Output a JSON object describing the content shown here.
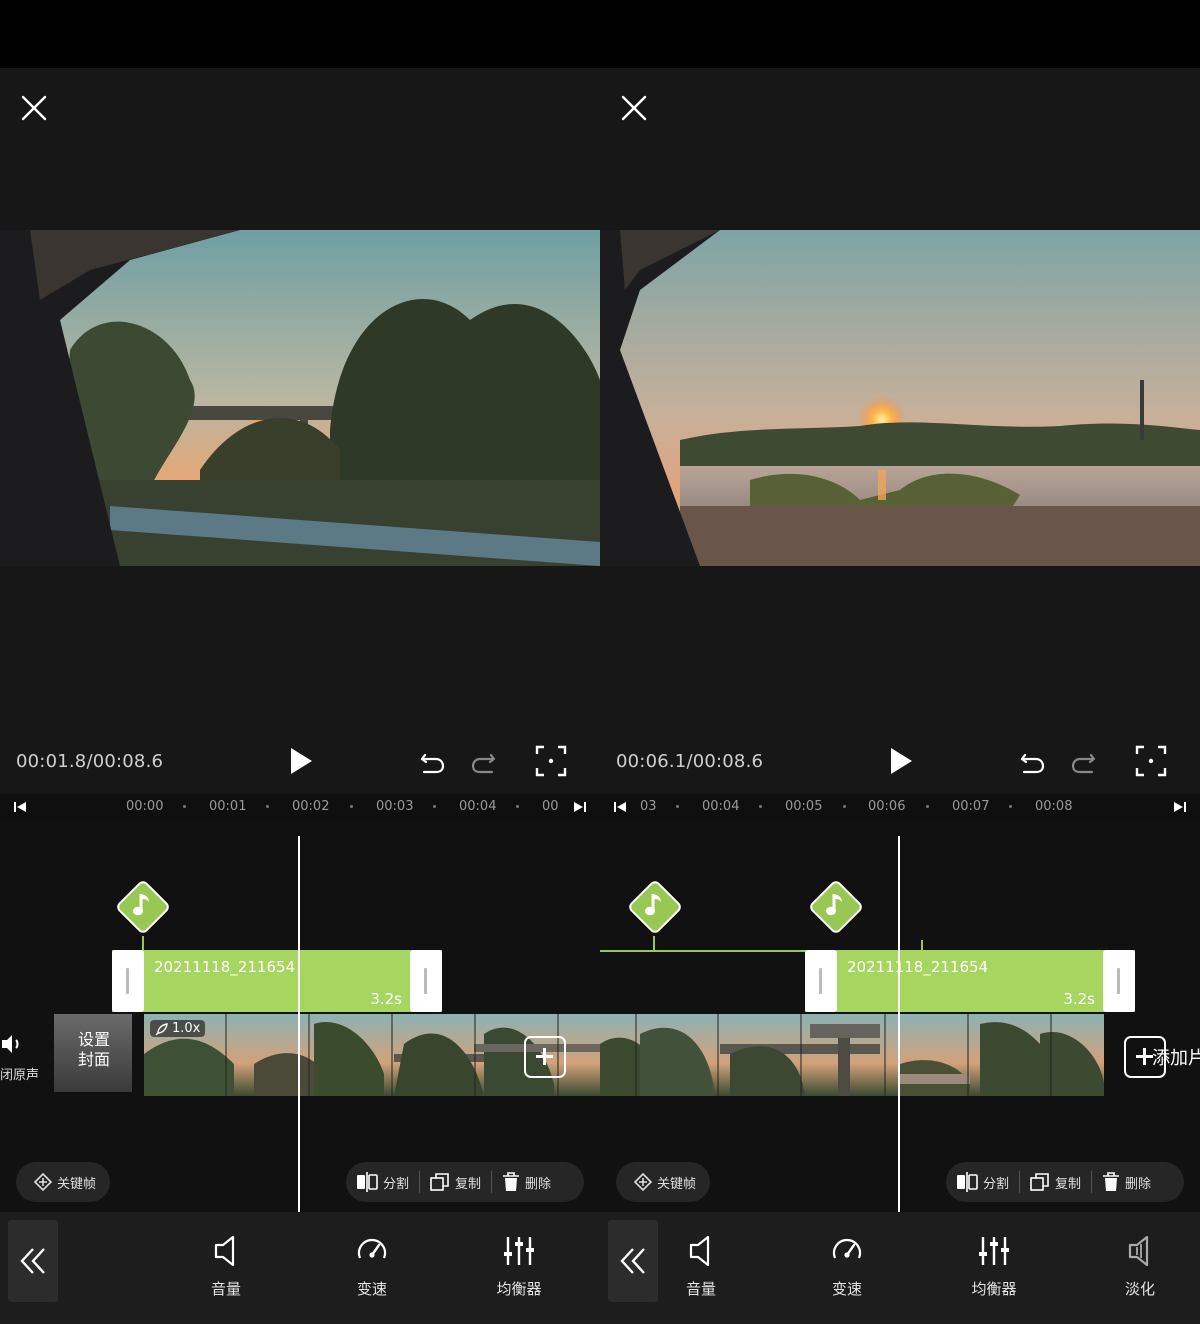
{
  "panels": [
    {
      "timecode": "00:01.8/00:08.6",
      "ruler_labels": [
        "00:00",
        "00:01",
        "00:02",
        "00:03",
        "00:04",
        "00"
      ],
      "clip": {
        "name": "20211118_211654",
        "duration": "3.2s"
      },
      "speed_badge": "1.0x",
      "cover_label": "设置封面",
      "mute_label": "闭原声",
      "actions": {
        "keyframe": "关键帧",
        "split": "分割",
        "copy": "复制",
        "delete": "删除"
      },
      "tools": [
        "音量",
        "变速",
        "均衡器"
      ]
    },
    {
      "timecode": "00:06.1/00:08.6",
      "ruler_labels": [
        "03",
        "00:04",
        "00:05",
        "00:06",
        "00:07",
        "00:08"
      ],
      "clip": {
        "name": "20211118_211654",
        "duration": "3.2s"
      },
      "add_clip_label": "添加片",
      "actions": {
        "keyframe": "关键帧",
        "split": "分割",
        "copy": "复制",
        "delete": "删除"
      },
      "tools": [
        "音量",
        "变速",
        "均衡器",
        "淡化"
      ]
    }
  ],
  "colors": {
    "accent": "#a6d560",
    "background": "#171717",
    "toolbar": "#1d1d1d"
  },
  "icons": [
    "close-icon",
    "play-icon",
    "undo-icon",
    "redo-icon",
    "fullscreen-icon",
    "music-note-icon",
    "volume-icon",
    "speed-icon",
    "equalizer-icon",
    "fade-icon",
    "keyframe-icon",
    "split-icon",
    "copy-icon",
    "delete-icon",
    "back-icon"
  ]
}
